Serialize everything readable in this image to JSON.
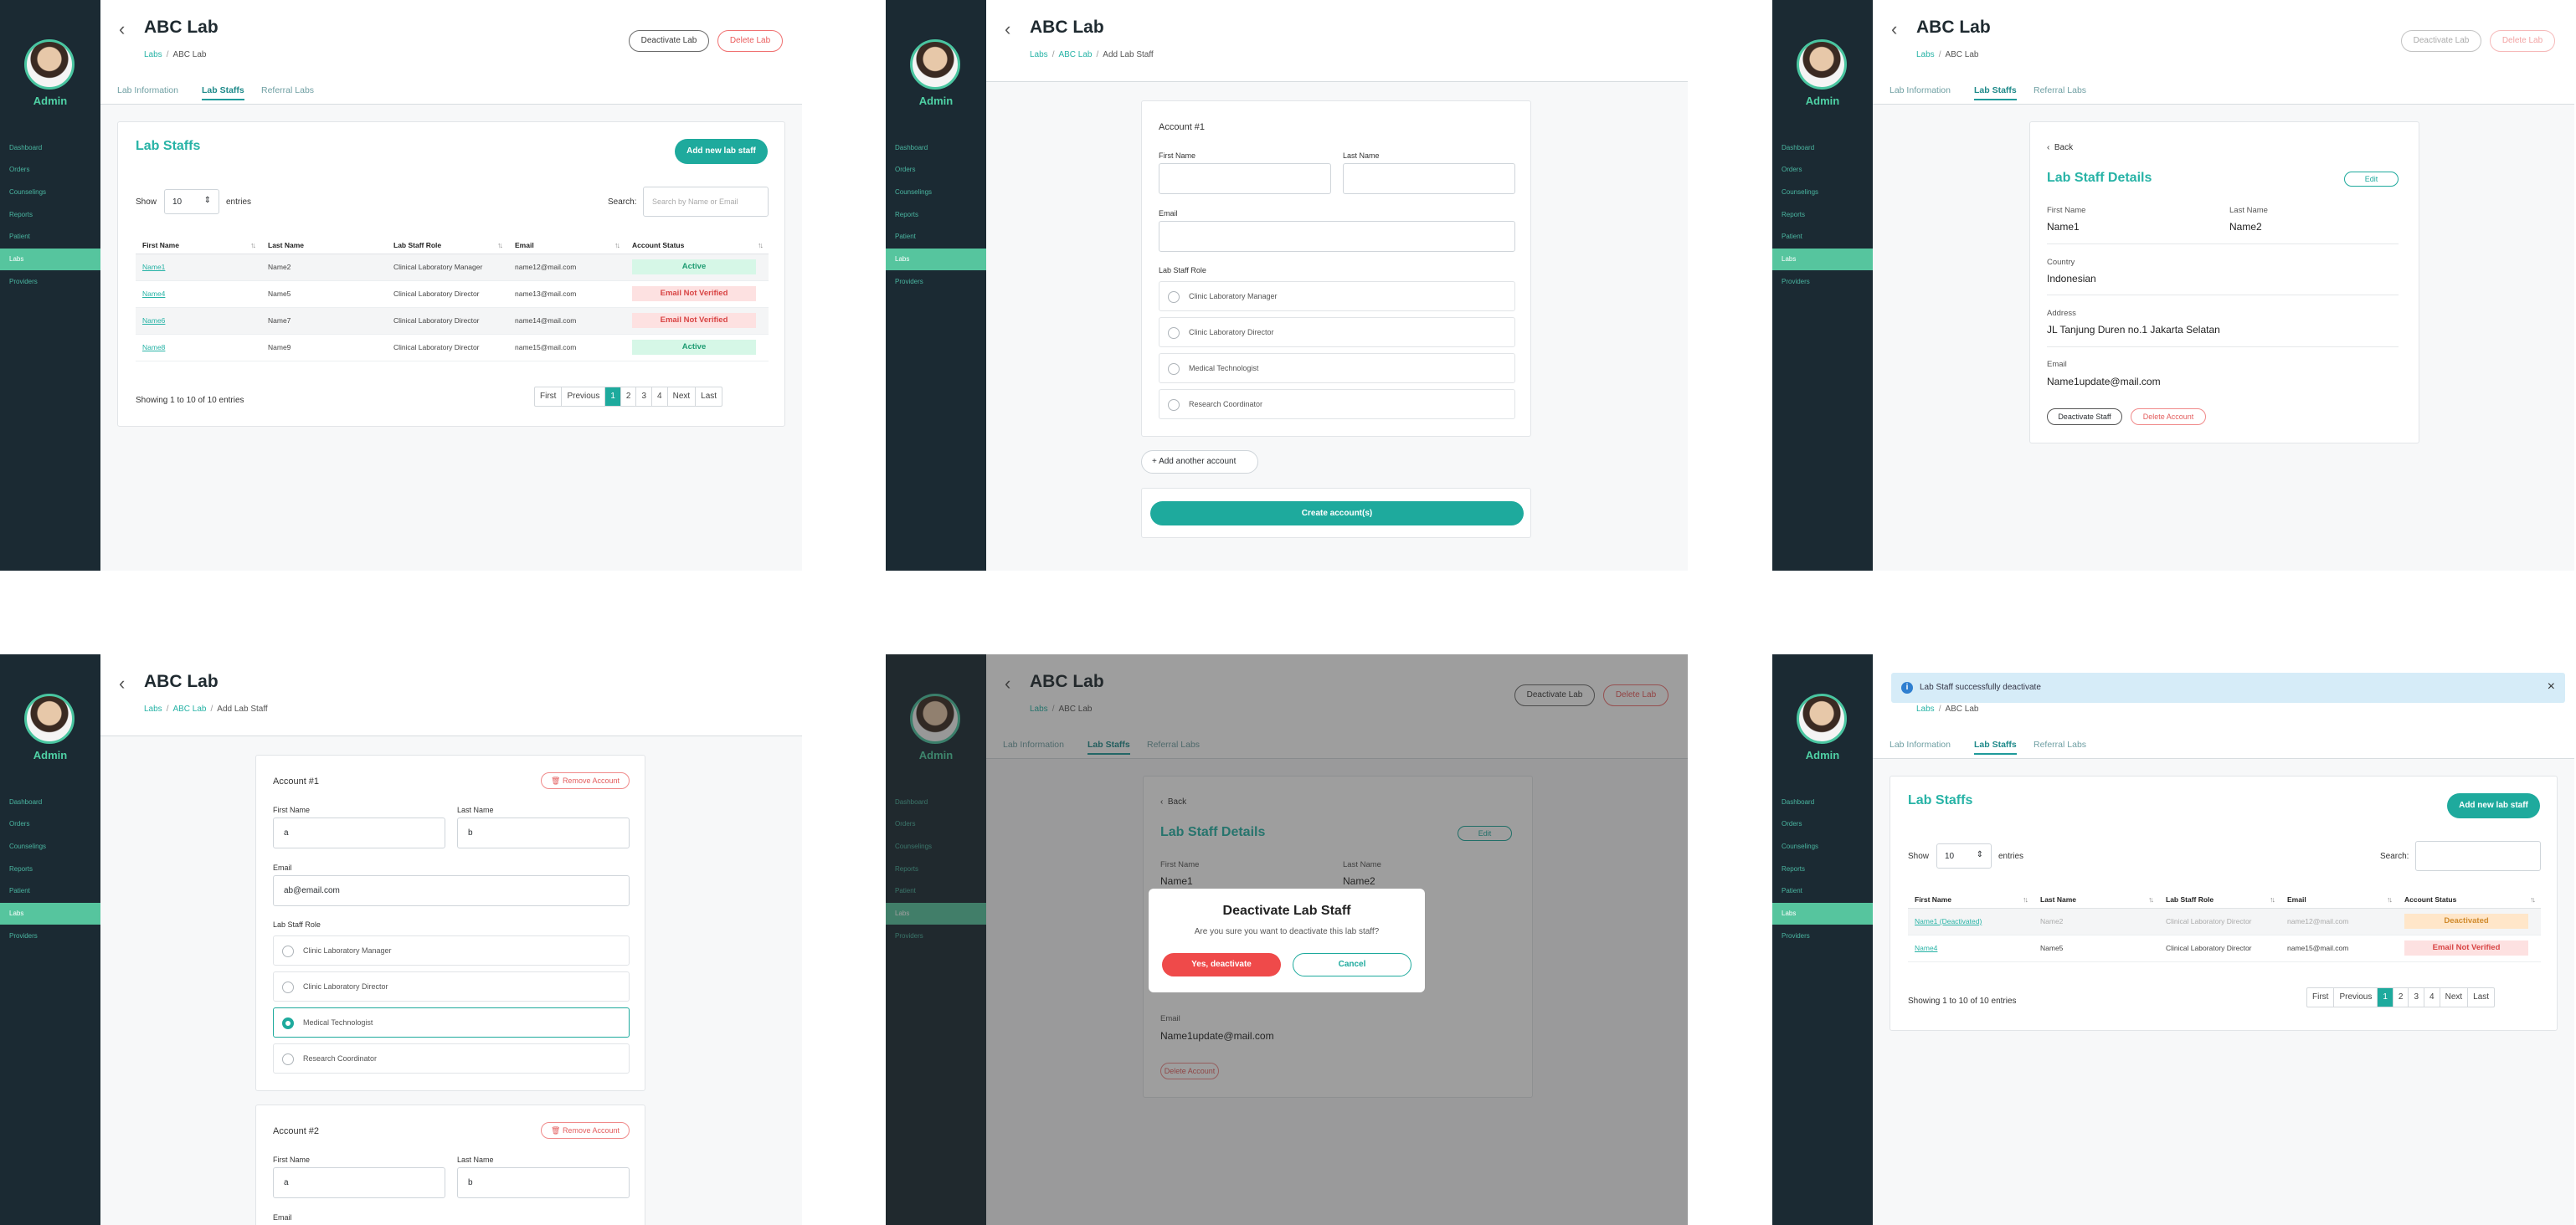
{
  "sidebar": {
    "user_label": "Admin",
    "items": [
      "Dashboard",
      "Orders",
      "Counselings",
      "Reports",
      "Patient",
      "Labs",
      "Providers"
    ],
    "active_item": "Labs"
  },
  "common": {
    "lab_name": "ABC Lab",
    "crumb_labs": "Labs",
    "crumb_sep": "/",
    "crumb_lab": "ABC Lab",
    "crumb_add": "Add Lab Staff",
    "deactivate_lab": "Deactivate Lab",
    "delete_lab": "Delete Lab",
    "tabs": [
      "Lab Information",
      "Lab Staffs",
      "Referral Labs"
    ]
  },
  "staff_list": {
    "title": "Lab Staffs",
    "add_button": "Add new lab staff",
    "show_label": "Show",
    "entries_value": "10",
    "entries_label": "entries",
    "search_label": "Search:",
    "search_placeholder": "Search by Name or Email",
    "columns": [
      "First Name",
      "Last Name",
      "Lab Staff Role",
      "Email",
      "Account Status"
    ],
    "rows": [
      {
        "first": "Name1",
        "last": "Name2",
        "role": "Clinical Laboratory Manager",
        "email": "name12@mail.com",
        "status": "Active"
      },
      {
        "first": "Name4",
        "last": "Name5",
        "role": "Clinical Laboratory Director",
        "email": "name13@mail.com",
        "status": "Email Not Verified"
      },
      {
        "first": "Name6",
        "last": "Name7",
        "role": "Clinical Laboratory Director",
        "email": "name14@mail.com",
        "status": "Email Not Verified"
      },
      {
        "first": "Name8",
        "last": "Name9",
        "role": "Clinical Laboratory Director",
        "email": "name15@mail.com",
        "status": "Active"
      }
    ],
    "footer": "Showing 1 to 10 of 10 entries",
    "pager": [
      "First",
      "Previous",
      "1",
      "2",
      "3",
      "4",
      "Next",
      "Last"
    ]
  },
  "add_form": {
    "account_title": "Account #1",
    "account2_title": "Account #2",
    "first_name": "First Name",
    "last_name": "Last Name",
    "email": "Email",
    "role_label": "Lab Staff Role",
    "roles": [
      "Clinic Laboratory Manager",
      "Clinic Laboratory Director",
      "Medical Technologist",
      "Research Coordinator"
    ],
    "add_another": "Add another account",
    "create": "Create account(s)",
    "remove": "Remove Account",
    "filled": {
      "first": "a",
      "last": "b",
      "email": "ab@email.com"
    }
  },
  "details": {
    "back": "Back",
    "title": "Lab Staff Details",
    "edit": "Edit",
    "first_label": "First Name",
    "first_value": "Name1",
    "last_label": "Last Name",
    "last_value": "Name2",
    "country_label": "Country",
    "country_value": "Indonesian",
    "address_label": "Address",
    "address_value": "JL Tanjung Duren no.1 Jakarta Selatan",
    "email_label": "Email",
    "email_value": "Name1update@mail.com",
    "deactivate_staff": "Deactivate Staff",
    "delete_account": "Delete Account"
  },
  "modal": {
    "title": "Deactivate Lab Staff",
    "text": "Are you sure you want to deactivate this lab staff?",
    "confirm": "Yes, deactivate",
    "cancel": "Cancel"
  },
  "after": {
    "toast": "Lab Staff successfully deactivate",
    "rows": [
      {
        "first": "Name1 (Deactivated)",
        "last": "Name2",
        "role": "Clinical Laboratory Director",
        "email": "name12@mail.com",
        "status": "Deactivated"
      },
      {
        "first": "Name4",
        "last": "Name5",
        "role": "Clinical Laboratory Director",
        "email": "name15@mail.com",
        "status": "Email Not Verified"
      }
    ]
  },
  "colors": {
    "accent": "#1eaa9d",
    "sidebar": "#1b2a33",
    "active_nav": "#56c59e",
    "danger": "#ef4a4a"
  }
}
